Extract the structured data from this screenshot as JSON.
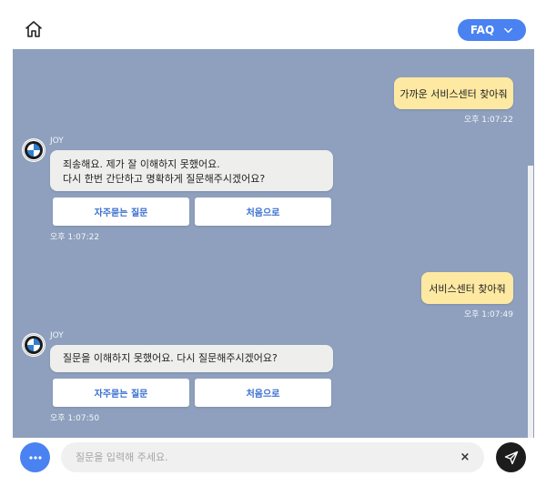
{
  "header": {
    "faq_label": "FAQ"
  },
  "messages": {
    "user1": {
      "text": "가까운 서비스센터 찾아줘",
      "time": "오후 1:07:22"
    },
    "bot1": {
      "name": "JOY",
      "line1": "죄송해요. 제가 잘 이해하지 못했어요.",
      "line2": "다시 한번 간단하고 명확하게 질문해주시겠어요?",
      "btn_faq": "자주묻는 질문",
      "btn_home": "처음으로",
      "time": "오후 1:07:22"
    },
    "user2": {
      "text": "서비스센터 찾아줘",
      "time": "오후 1:07:49"
    },
    "bot2": {
      "name": "JOY",
      "line1": "질문을 이해하지 못했어요. 다시 질문해주시겠어요?",
      "btn_faq": "자주묻는 질문",
      "btn_home": "처음으로",
      "time": "오후 1:07:50"
    }
  },
  "input": {
    "placeholder": "질문을 입력해 주세요.",
    "value": "",
    "clear_label": "×"
  },
  "colors": {
    "accent": "#4a82f2",
    "chat_bg": "#8ea0bd",
    "user_bubble": "#fde9a2",
    "bot_bubble": "#eeeeec"
  },
  "icons": {
    "home": "home-icon",
    "chevron": "chevron-down-icon",
    "avatar": "bmw-logo-icon",
    "menu": "more-dots-icon",
    "send": "send-icon"
  }
}
